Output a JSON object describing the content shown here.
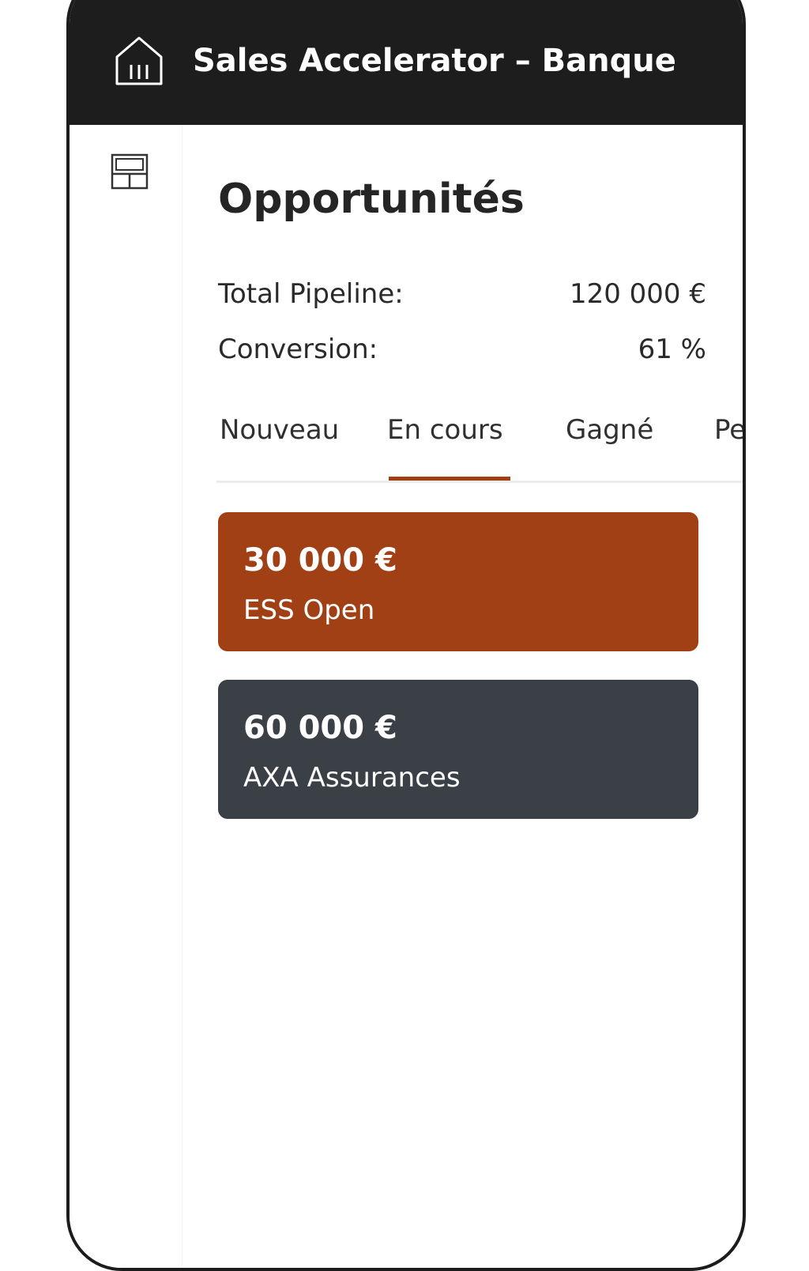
{
  "app": {
    "title": "Sales Accelerator – Banque",
    "home_icon": "home-icon"
  },
  "sidebar": {
    "icon": "layout-grid-icon"
  },
  "page": {
    "title": "Opportunités"
  },
  "stats": [
    {
      "label": "Total Pipeline:",
      "value": "120 000 €"
    },
    {
      "label": "Conversion:",
      "value": "61 %"
    }
  ],
  "tabs": [
    {
      "label": "Nouveau",
      "active": false
    },
    {
      "label": "En cours",
      "active": true
    },
    {
      "label": "Gagné",
      "active": false
    },
    {
      "label": "Perdu",
      "active": false
    }
  ],
  "opportunities": [
    {
      "amount": "30 000 €",
      "client": "ESS Open",
      "color": "#a14014"
    },
    {
      "amount": "60 000 €",
      "client": "AXA Assurances",
      "color": "#3b4047"
    }
  ],
  "colors": {
    "header_bg": "#1d1d1d",
    "accent": "#a14014",
    "card_dark": "#3b4047"
  }
}
